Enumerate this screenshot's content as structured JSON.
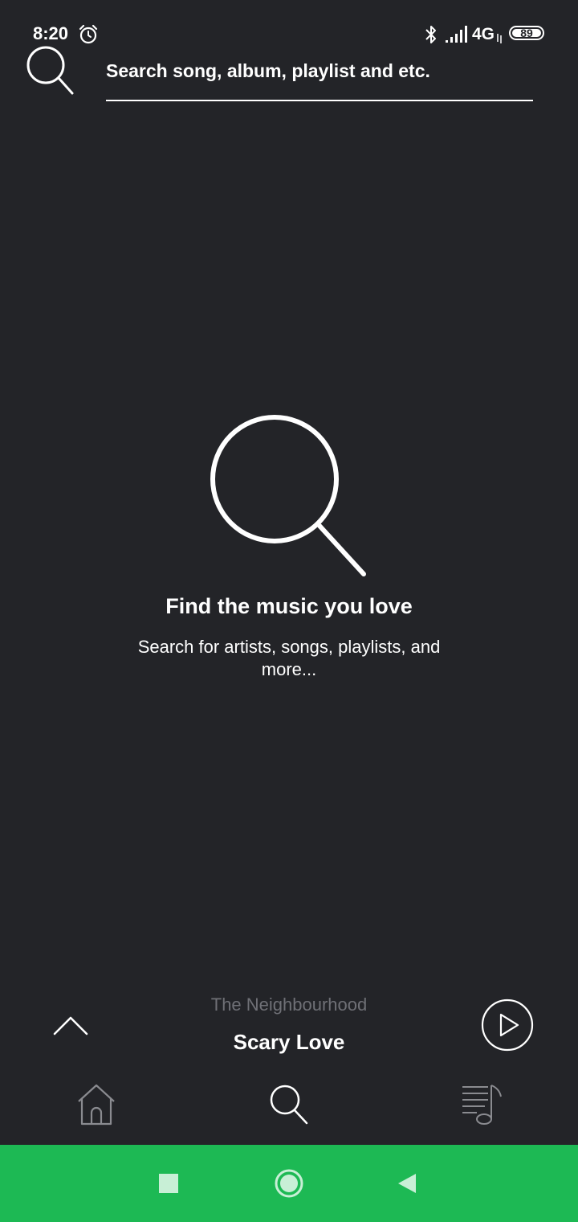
{
  "status_bar": {
    "time": "8:20",
    "network": "4G",
    "battery": "89"
  },
  "search": {
    "placeholder": "Search song, album, playlist and etc.",
    "value": ""
  },
  "empty_state": {
    "title": "Find the music you love",
    "subtitle": "Search for artists, songs, playlists, and more..."
  },
  "now_playing": {
    "artist": "The Neighbourhood",
    "title": "Scary Love"
  },
  "bottom_nav": {
    "items": [
      {
        "id": "home",
        "icon": "home-icon",
        "active": false
      },
      {
        "id": "search",
        "icon": "search-icon",
        "active": true
      },
      {
        "id": "library",
        "icon": "playlist-music-icon",
        "active": false
      }
    ]
  },
  "colors": {
    "background": "#232428",
    "text": "#ffffff",
    "muted_text": "#6f7076",
    "inactive_icon": "#8a8b90",
    "system_nav": "#1db954"
  }
}
